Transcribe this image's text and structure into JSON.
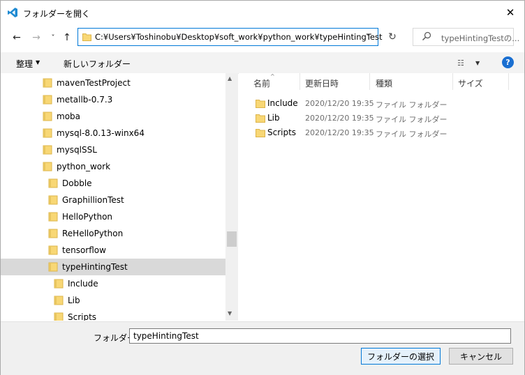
{
  "window": {
    "title": "フォルダーを開く",
    "close_glyph": "✕"
  },
  "nav": {
    "back_glyph": "←",
    "forward_glyph": "→",
    "recent_glyph": "˅",
    "up_glyph": "↑",
    "address": "C:¥Users¥Toshinobu¥Desktop¥soft_work¥python_work¥typeHintingTest",
    "address_caret": "˅",
    "refresh_glyph": "↻",
    "search_placeholder": "typeHintingTestの..."
  },
  "toolbar": {
    "organize_label": "整理",
    "organize_caret": "▼",
    "new_folder_label": "新しいフォルダー",
    "view_glyph": "☷",
    "view_caret": "▼",
    "help_glyph": "?"
  },
  "tree": {
    "items": [
      {
        "label": "mavenTestProject",
        "indent": 0,
        "selected": false
      },
      {
        "label": "metallb-0.7.3",
        "indent": 0,
        "selected": false
      },
      {
        "label": "moba",
        "indent": 0,
        "selected": false
      },
      {
        "label": "mysql-8.0.13-winx64",
        "indent": 0,
        "selected": false
      },
      {
        "label": "mysqlSSL",
        "indent": 0,
        "selected": false
      },
      {
        "label": "python_work",
        "indent": 0,
        "selected": false
      },
      {
        "label": "Dobble",
        "indent": 1,
        "selected": false
      },
      {
        "label": "GraphillionTest",
        "indent": 1,
        "selected": false
      },
      {
        "label": "HelloPython",
        "indent": 1,
        "selected": false
      },
      {
        "label": "ReHelloPython",
        "indent": 1,
        "selected": false
      },
      {
        "label": "tensorflow",
        "indent": 1,
        "selected": false
      },
      {
        "label": "typeHintingTest",
        "indent": 1,
        "selected": true
      },
      {
        "label": "Include",
        "indent": 2,
        "selected": false
      },
      {
        "label": "Lib",
        "indent": 2,
        "selected": false
      },
      {
        "label": "Scripts",
        "indent": 2,
        "selected": false
      }
    ],
    "scroll_up_glyph": "▲",
    "scroll_down_glyph": "▼"
  },
  "files": {
    "columns": {
      "name": "名前",
      "modified": "更新日時",
      "type": "種類",
      "size": "サイズ"
    },
    "sort_glyph": "^",
    "rows": [
      {
        "name": "Include",
        "modified": "2020/12/20 19:35",
        "type": "ファイル フォルダー"
      },
      {
        "name": "Lib",
        "modified": "2020/12/20 19:35",
        "type": "ファイル フォルダー"
      },
      {
        "name": "Scripts",
        "modified": "2020/12/20 19:35",
        "type": "ファイル フォルダー"
      }
    ]
  },
  "footer": {
    "folder_label": "フォルダー:",
    "folder_value": "typeHintingTest",
    "select_button": "フォルダーの選択",
    "cancel_button": "キャンセル"
  },
  "colors": {
    "accent": "#0078d7",
    "folder": "#f8d775",
    "folder_border": "#dcb44a",
    "selected_row": "#d9d9d9"
  }
}
